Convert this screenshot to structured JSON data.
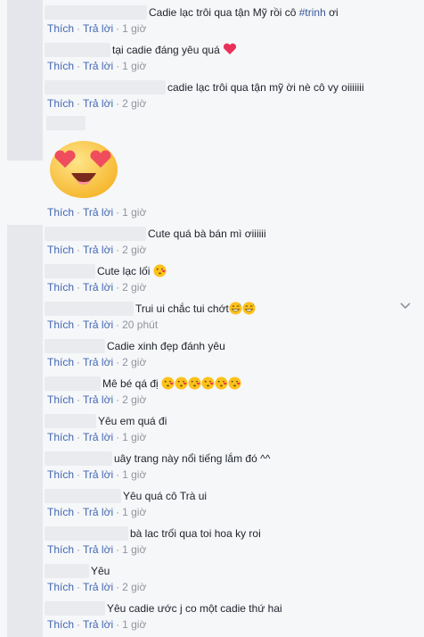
{
  "actions": {
    "like": "Thích",
    "reply": "Trả lời",
    "sep": "·"
  },
  "comments": [
    {
      "pre": "Cadie lạc trôi qua tận Mỹ rồi cô ",
      "tag": "#trinh",
      "post": " ơi",
      "time": "1 giờ"
    },
    {
      "text": "tại cadie đáng yêu quá",
      "time": "1 giờ"
    },
    {
      "text": "cadie lạc trôi qua tận mỹ ời nè cô vy oiiiiiii",
      "time": "2 giờ"
    },
    {
      "sticker": "heart-eyes-sticker",
      "time": "1 giờ"
    },
    {
      "text": "Cute quá bà bán mì ơiiiiii",
      "time": "2 giờ"
    },
    {
      "text": "Cute lạc lối",
      "time": "2 giờ"
    },
    {
      "text": "Trui ui chắc tui chớt",
      "time": "20 phút"
    },
    {
      "text": "Cadie xinh đẹp đánh yêu",
      "time": "2 giờ"
    },
    {
      "text": "Mê bé qá đị",
      "time": "2 giờ"
    },
    {
      "text": "Yêu em quá đi",
      "time": "1 giờ"
    },
    {
      "text": "uây trang này nổi tiếng lắm đó ^^",
      "time": "1 giờ"
    },
    {
      "text": "Yêu quá cô Trà ui",
      "time": "1 giờ"
    },
    {
      "text": "bà lac trối qua toi hoa ky roi",
      "time": "1 giờ"
    },
    {
      "text": "Yêu",
      "time": "2 giờ"
    },
    {
      "text": "Yêu cadie ước j co một cadie thứ hai",
      "time": "1 giờ"
    }
  ],
  "colors": {
    "link": "#4267b2",
    "meta": "#90949c",
    "text": "#1d2129",
    "bg": "#f6f7f9"
  }
}
